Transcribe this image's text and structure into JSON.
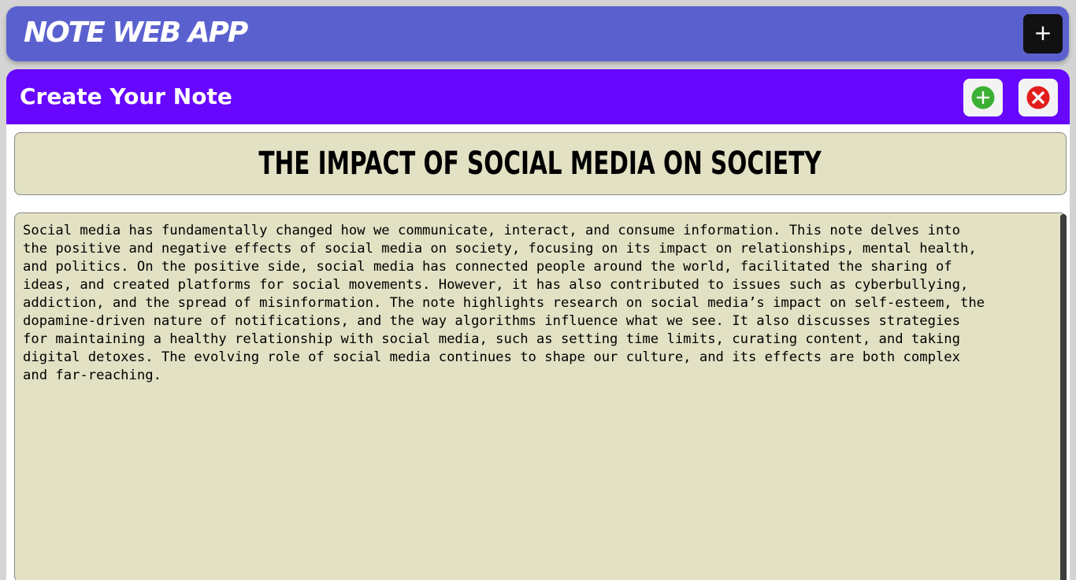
{
  "header": {
    "app_title": "NOTE WEB APP",
    "new_note_label": "+"
  },
  "editor": {
    "panel_title": "Create Your Note",
    "note_title": "THE IMPACT OF SOCIAL MEDIA ON SOCIETY",
    "note_body": "Social media has fundamentally changed how we communicate, interact, and consume information. This note delves into\nthe positive and negative effects of social media on society, focusing on its impact on relationships, mental health,\nand politics. On the positive side, social media has connected people around the world, facilitated the sharing of\nideas, and created platforms for social movements. However, it has also contributed to issues such as cyberbullying,\naddiction, and the spread of misinformation. The note highlights research on social media’s impact on self-esteem, the\ndopamine-driven nature of notifications, and the way algorithms influence what we see. It also discusses strategies\nfor maintaining a healthy relationship with social media, such as setting time limits, curating content, and taking\ndigital detoxes. The evolving role of social media continues to shape our culture, and its effects are both complex\nand far-reaching.",
    "save_icon": "add-circle-icon",
    "close_icon": "close-circle-icon"
  },
  "colors": {
    "header_bg": "#5a61cf",
    "panel_head_bg": "#6707fe",
    "note_bg": "#e2e1c4",
    "save_green": "#3cb034",
    "close_red": "#e21d1d"
  }
}
